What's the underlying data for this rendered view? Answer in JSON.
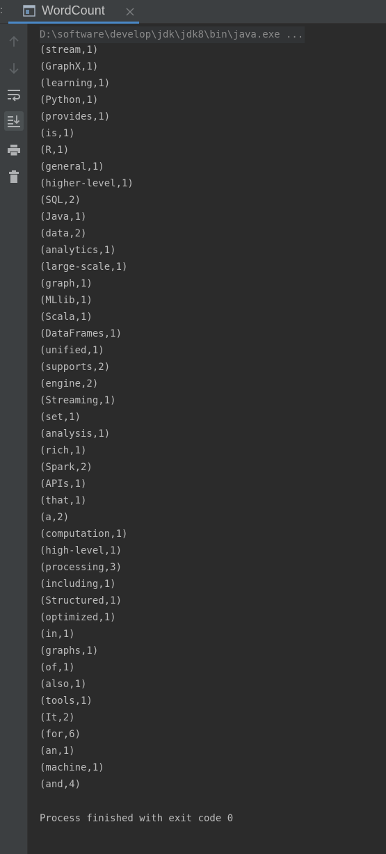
{
  "tab_prefix": ":",
  "tab": {
    "title": "WordCount",
    "icon": "console-window-icon",
    "close_icon": "close-icon"
  },
  "toolbar": {
    "items": [
      {
        "name": "scroll-up-icon",
        "enabled": false
      },
      {
        "name": "scroll-down-icon",
        "enabled": false
      },
      {
        "name": "soft-wrap-icon",
        "enabled": true
      },
      {
        "name": "scroll-to-end-icon",
        "enabled": true,
        "active": true
      },
      {
        "name": "print-icon",
        "enabled": true
      },
      {
        "name": "clear-all-icon",
        "enabled": true
      }
    ]
  },
  "console": {
    "command": "D:\\software\\develop\\jdk\\jdk8\\bin\\java.exe ...",
    "lines": [
      "(stream,1)",
      "(GraphX,1)",
      "(learning,1)",
      "(Python,1)",
      "(provides,1)",
      "(is,1)",
      "(R,1)",
      "(general,1)",
      "(higher-level,1)",
      "(SQL,2)",
      "(Java,1)",
      "(data,2)",
      "(analytics,1)",
      "(large-scale,1)",
      "(graph,1)",
      "(MLlib,1)",
      "(Scala,1)",
      "(DataFrames,1)",
      "(unified,1)",
      "(supports,2)",
      "(engine,2)",
      "(Streaming,1)",
      "(set,1)",
      "(analysis,1)",
      "(rich,1)",
      "(Spark,2)",
      "(APIs,1)",
      "(that,1)",
      "(a,2)",
      "(computation,1)",
      "(high-level,1)",
      "(processing,3)",
      "(including,1)",
      "(Structured,1)",
      "(optimized,1)",
      "(in,1)",
      "(graphs,1)",
      "(of,1)",
      "(also,1)",
      "(tools,1)",
      "(It,2)",
      "(for,6)",
      "(an,1)",
      "(machine,1)",
      "(and,4)"
    ],
    "exit_message": "Process finished with exit code 0"
  },
  "colors": {
    "background": "#2b2b2b",
    "panel": "#3c3f41",
    "text": "#bbbbbb",
    "dim_text": "#8a8a8a",
    "tab_underline": "#4a88c7",
    "icon_disabled": "#5e6265",
    "icon_enabled": "#afb1b3"
  }
}
